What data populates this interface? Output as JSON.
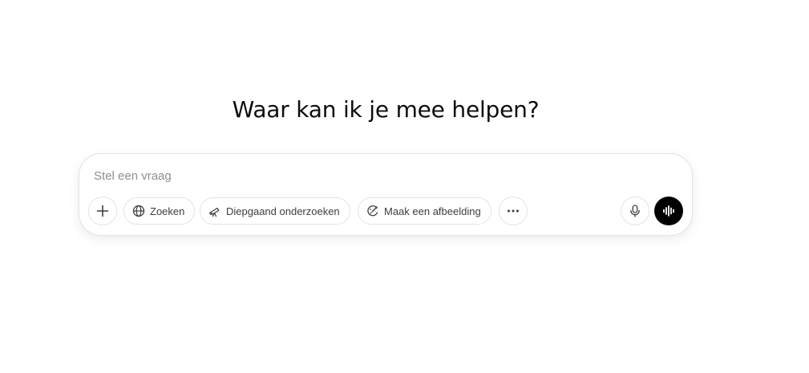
{
  "main": {
    "heading": "Waar kan ik je mee helpen?"
  },
  "composer": {
    "placeholder": "Stel een vraag",
    "value": "",
    "tools": [
      {
        "label": "Zoeken",
        "icon": "globe-icon"
      },
      {
        "label": "Diepgaand onderzoeken",
        "icon": "telescope-icon"
      },
      {
        "label": "Maak een afbeelding",
        "icon": "image-brush-icon"
      }
    ],
    "icons": {
      "attach": "plus-icon",
      "more": "more-horizontal-icon",
      "mic": "microphone-icon",
      "voice": "voice-mode-icon"
    },
    "colors": {
      "voice_button_bg": "#000000",
      "border": "#e3e3e3",
      "placeholder": "#8f8f8f"
    }
  }
}
